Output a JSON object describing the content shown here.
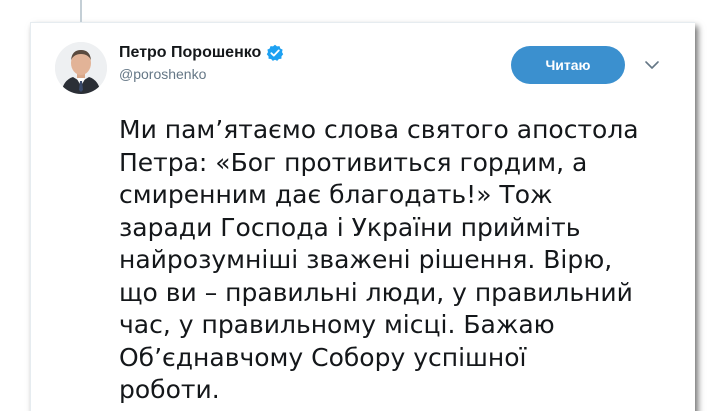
{
  "tweet": {
    "author": {
      "display_name": "Петро Порошенко",
      "handle": "@poroshenko",
      "verified": true,
      "avatar_icon": "profile-photo"
    },
    "follow_button_label": "Читаю",
    "menu_icon": "chevron-down-icon",
    "text_lines": [
      "Ми пам’ятаємо слова святого апостола",
      "Петра: «Бог противиться гордим, а",
      "смиренним дає благодать!» Тож",
      "заради Господа і України прийміть",
      "найрозумніші зважені рішення.  Вірю,",
      "що ви – правильні люди, у правильний",
      "час, у правильному місці. Бажаю",
      "Об’єднавчому Собору успішної",
      "роботи."
    ]
  },
  "colors": {
    "accent": "#3b90cf",
    "verified_badge": "#1da1f2",
    "text_primary": "#14171a",
    "text_secondary": "#657786",
    "thread_line": "#c4cfd6"
  }
}
